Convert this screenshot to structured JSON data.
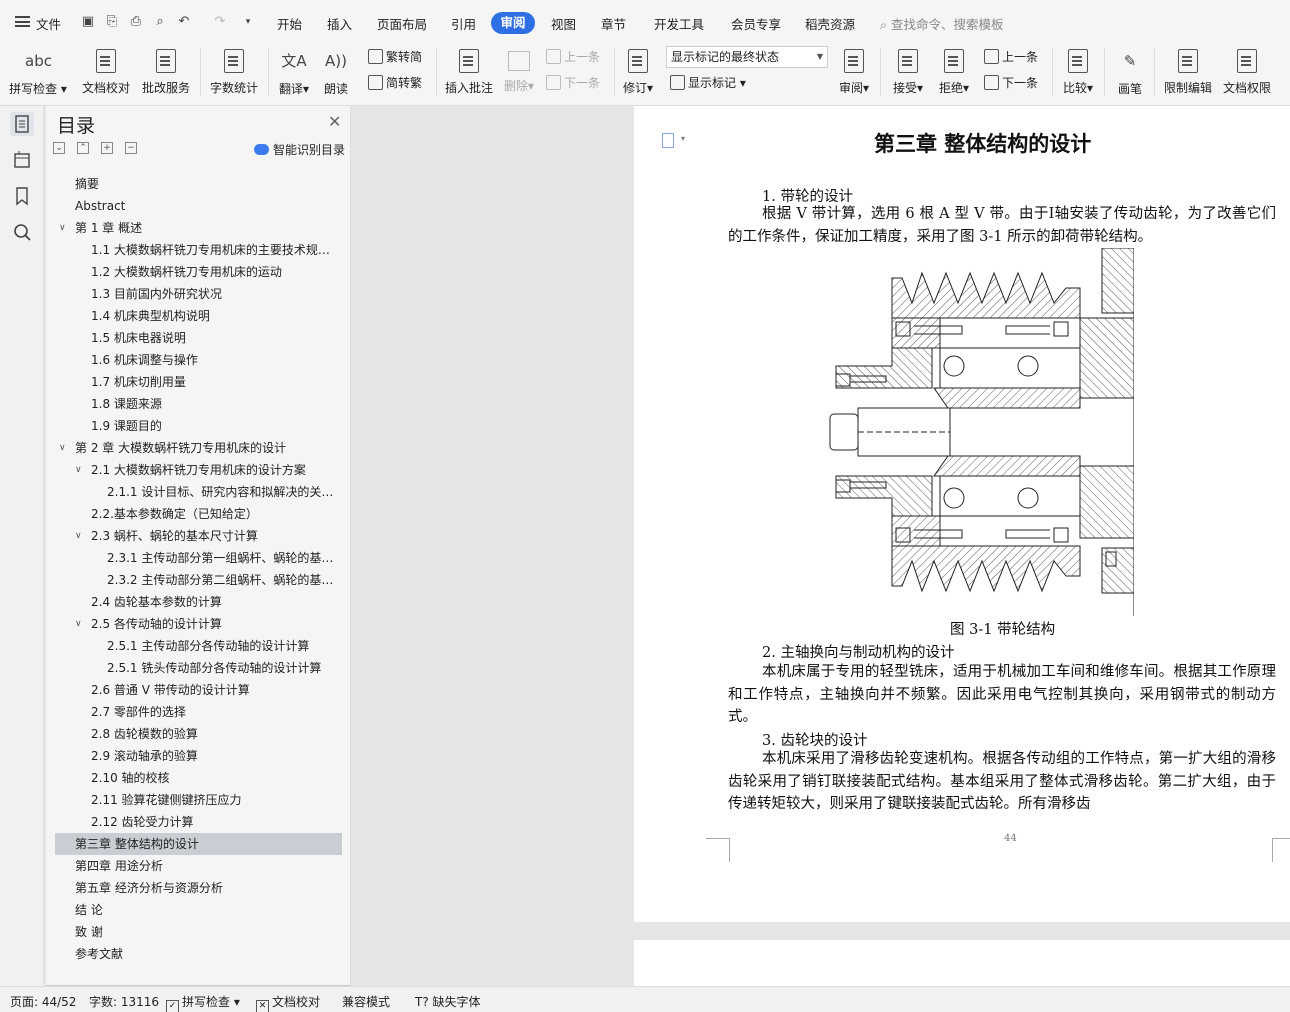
{
  "menubar": {
    "file": "文件",
    "tabs": [
      "开始",
      "插入",
      "页面布局",
      "引用",
      "审阅",
      "视图",
      "章节",
      "开发工具",
      "会员专享",
      "稻壳资源"
    ],
    "active_tab": "审阅",
    "search_placeholder": "查找命令、搜索模板"
  },
  "ribbon": {
    "spell": "拼写检查",
    "proof": "文档校对",
    "review_service": "批改服务",
    "word_count": "字数统计",
    "translate": "翻译",
    "read_aloud": "朗读",
    "trad": "繁转简",
    "simp": "简转繁",
    "insert_comment": "插入批注",
    "delete": "删除",
    "prev_comment": "上一条",
    "next_comment": "下一条",
    "track": "修订",
    "markup_select": "显示标记的最终状态",
    "show_markup": "显示标记",
    "review": "审阅",
    "accept": "接受",
    "reject": "拒绝",
    "prev_change": "上一条",
    "next_change": "下一条",
    "compare": "比较",
    "pen": "画笔",
    "restrict": "限制编辑",
    "permission": "文档权限"
  },
  "toc": {
    "title": "目录",
    "smart": "智能识别目录",
    "items": [
      {
        "label": "摘要",
        "level": 0,
        "chev": ""
      },
      {
        "label": "Abstract",
        "level": 0,
        "chev": ""
      },
      {
        "label": "第 1 章   概述",
        "level": 0,
        "chev": "v"
      },
      {
        "label": "1.1 大模数蜗杆铣刀专用机床的主要技术规…",
        "level": 1,
        "chev": ""
      },
      {
        "label": "1.2 大模数蜗杆铣刀专用机床的运动",
        "level": 1,
        "chev": ""
      },
      {
        "label": "1.3 目前国内外研究状况",
        "level": 1,
        "chev": ""
      },
      {
        "label": "1.4 机床典型机构说明",
        "level": 1,
        "chev": ""
      },
      {
        "label": "1.5 机床电器说明",
        "level": 1,
        "chev": ""
      },
      {
        "label": "1.6 机床调整与操作",
        "level": 1,
        "chev": ""
      },
      {
        "label": "1.7 机床切削用量",
        "level": 1,
        "chev": ""
      },
      {
        "label": "1.8 课题来源",
        "level": 1,
        "chev": ""
      },
      {
        "label": "1.9 课题目的",
        "level": 1,
        "chev": ""
      },
      {
        "label": "第 2 章    大模数蜗杆铣刀专用机床的设计",
        "level": 0,
        "chev": "v"
      },
      {
        "label": "2.1 大模数蜗杆铣刀专用机床的设计方案",
        "level": 1,
        "chev": "v"
      },
      {
        "label": "2.1.1 设计目标、研究内容和拟解决的关…",
        "level": 2,
        "chev": ""
      },
      {
        "label": "2.2.基本参数确定（已知给定）",
        "level": 1,
        "chev": ""
      },
      {
        "label": "2.3 蜗杆、蜗轮的基本尺寸计算",
        "level": 1,
        "chev": "v"
      },
      {
        "label": "2.3.1 主传动部分第一组蜗杆、蜗轮的基…",
        "level": 2,
        "chev": ""
      },
      {
        "label": "2.3.2 主传动部分第二组蜗杆、蜗轮的基…",
        "level": 2,
        "chev": ""
      },
      {
        "label": "2.4 齿轮基本参数的计算",
        "level": 1,
        "chev": ""
      },
      {
        "label": "2.5 各传动轴的设计计算",
        "level": 1,
        "chev": "v"
      },
      {
        "label": "2.5.1 主传动部分各传动轴的设计计算",
        "level": 2,
        "chev": ""
      },
      {
        "label": "2.5.1 铣头传动部分各传动轴的设计计算",
        "level": 2,
        "chev": ""
      },
      {
        "label": "2.6 普通 V 带传动的设计计算",
        "level": 1,
        "chev": ""
      },
      {
        "label": "2.7 零部件的选择",
        "level": 1,
        "chev": ""
      },
      {
        "label": "2.8 齿轮模数的验算",
        "level": 1,
        "chev": ""
      },
      {
        "label": "2.9 滚动轴承的验算",
        "level": 1,
        "chev": ""
      },
      {
        "label": "2.10 轴的校核",
        "level": 1,
        "chev": ""
      },
      {
        "label": "2.11 验算花键侧键挤压应力",
        "level": 1,
        "chev": ""
      },
      {
        "label": "2.12 齿轮受力计算",
        "level": 1,
        "chev": ""
      },
      {
        "label": "第三章  整体结构的设计",
        "level": 0,
        "chev": "",
        "selected": true
      },
      {
        "label": "第四章  用途分析",
        "level": 0,
        "chev": ""
      },
      {
        "label": "第五章  经济分析与资源分析",
        "level": 0,
        "chev": ""
      },
      {
        "label": "结    论",
        "level": 0,
        "chev": ""
      },
      {
        "label": "致    谢",
        "level": 0,
        "chev": ""
      },
      {
        "label": "参考文献",
        "level": 0,
        "chev": ""
      }
    ]
  },
  "doc": {
    "title": "第三章  整体结构的设计",
    "h1": "1.  带轮的设计",
    "p1": "根据 V 带计算，选用 6 根 A 型 V 带。由于Ⅰ轴安装了传动齿轮，为了改善它们的工作条件，保证加工精度，采用了图 3-1 所示的卸荷带轮结构。",
    "caption": "图 3-1  带轮结构",
    "h2": "2.  主轴换向与制动机构的设计",
    "p2": "本机床属于专用的轻型铣床，适用于机械加工车间和维修车间。根据其工作原理和工作特点，主轴换向并不频繁。因此采用电气控制其换向，采用钢带式的制动方式。",
    "h3": "3.  齿轮块的设计",
    "p3": "本机床采用了滑移齿轮变速机构。根据各传动组的工作特点，第一扩大组的滑移齿轮采用了销钉联接装配式结构。基本组采用了整体式滑移齿轮。第二扩大组，由于传递转矩较大，则采用了键联接装配式齿轮。所有滑移齿",
    "page_number": "44"
  },
  "status": {
    "page": "页面: 44/52",
    "words": "字数: 13116",
    "spell": "拼写检查",
    "proof": "文档校对",
    "compat": "兼容模式",
    "missing_font": "缺失字体"
  },
  "colors": {
    "accent": "#2f6fe4",
    "toc_selected": "#c9cdd4"
  }
}
